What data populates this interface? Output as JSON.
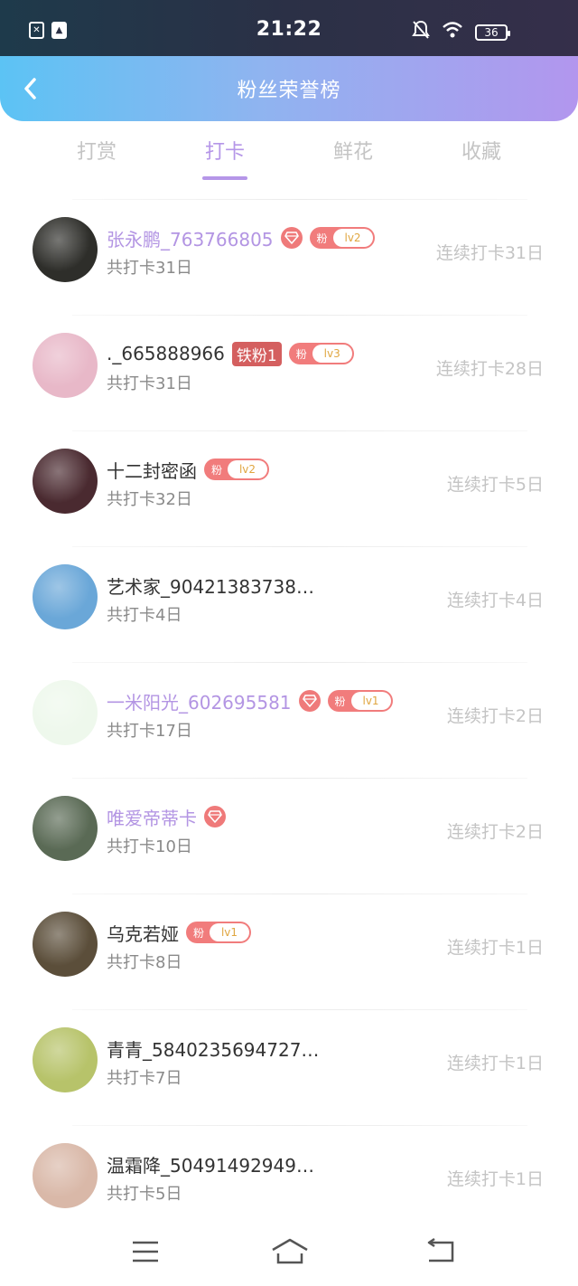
{
  "status_bar": {
    "time": "21:22",
    "battery": "36",
    "left_icons": [
      "sim-icon",
      "gallery-icon"
    ],
    "right_icons": [
      "bell-off-icon",
      "wifi-icon",
      "battery-icon"
    ]
  },
  "header": {
    "title": "粉丝荣誉榜",
    "back_icon": "chevron-left-icon"
  },
  "tabs": [
    {
      "label": "打赏",
      "active": false
    },
    {
      "label": "打卡",
      "active": true
    },
    {
      "label": "鲜花",
      "active": false
    },
    {
      "label": "收藏",
      "active": false
    }
  ],
  "colors": {
    "accent": "#b596e8",
    "badge_red": "#f17c7c",
    "iron_badge": "#d45f5f",
    "muted": "#c4c4c4"
  },
  "list": [
    {
      "name": "张永鹏_763766805",
      "vip": true,
      "diamond": true,
      "iron": "",
      "fan_label": "粉",
      "fan_level": "lv2",
      "total": "共打卡31日",
      "streak": "连续打卡31日",
      "avatar_color": "#2e2e2a"
    },
    {
      "name": "._665888966",
      "vip": false,
      "diamond": false,
      "iron": "铁粉1",
      "fan_label": "粉",
      "fan_level": "lv3",
      "total": "共打卡31日",
      "streak": "连续打卡28日",
      "avatar_color": "#e8b8c8"
    },
    {
      "name": "十二封密函",
      "vip": false,
      "diamond": false,
      "iron": "",
      "fan_label": "粉",
      "fan_level": "lv2",
      "total": "共打卡32日",
      "streak": "连续打卡5日",
      "avatar_color": "#4a2a30"
    },
    {
      "name": "艺术家_90421383738…",
      "vip": false,
      "diamond": false,
      "iron": "",
      "fan_label": "",
      "fan_level": "",
      "total": "共打卡4日",
      "streak": "连续打卡4日",
      "avatar_color": "#6aa7d8"
    },
    {
      "name": "一米阳光_602695581",
      "vip": true,
      "diamond": true,
      "iron": "",
      "fan_label": "粉",
      "fan_level": "lv1",
      "total": "共打卡17日",
      "streak": "连续打卡2日",
      "avatar_color": "#eef8ec"
    },
    {
      "name": "唯爱帝蒂卡",
      "vip": true,
      "diamond": true,
      "iron": "",
      "fan_label": "",
      "fan_level": "",
      "total": "共打卡10日",
      "streak": "连续打卡2日",
      "avatar_color": "#5a6a55"
    },
    {
      "name": "乌克若娅",
      "vip": false,
      "diamond": false,
      "iron": "",
      "fan_label": "粉",
      "fan_level": "lv1",
      "total": "共打卡8日",
      "streak": "连续打卡1日",
      "avatar_color": "#5b4e3a"
    },
    {
      "name": "青青_5840235694727…",
      "vip": false,
      "diamond": false,
      "iron": "",
      "fan_label": "",
      "fan_level": "",
      "total": "共打卡7日",
      "streak": "连续打卡1日",
      "avatar_color": "#b7c36a"
    },
    {
      "name": "温霜降_50491492949…",
      "vip": false,
      "diamond": false,
      "iron": "",
      "fan_label": "",
      "fan_level": "",
      "total": "共打卡5日",
      "streak": "连续打卡1日",
      "avatar_color": "#d9b8a8"
    }
  ],
  "bottom_nav": [
    {
      "icon": "menu-icon"
    },
    {
      "icon": "home-icon"
    },
    {
      "icon": "back-icon"
    }
  ]
}
